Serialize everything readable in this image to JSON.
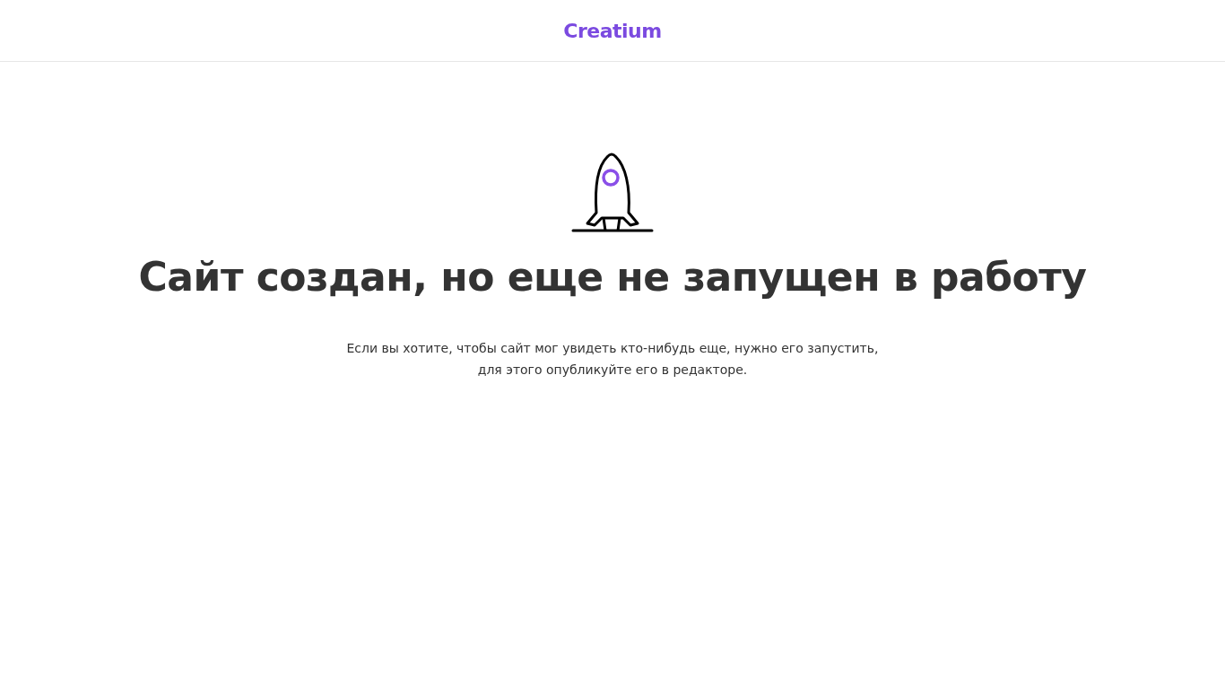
{
  "header": {
    "logo": "Creatium"
  },
  "message": {
    "title": "Сайт создан, но еще не запущен в работу",
    "text": "Если вы хотите, чтобы сайт мог увидеть кто-нибудь еще, нужно его запустить, для этого опубликуйте его в редакторе."
  }
}
